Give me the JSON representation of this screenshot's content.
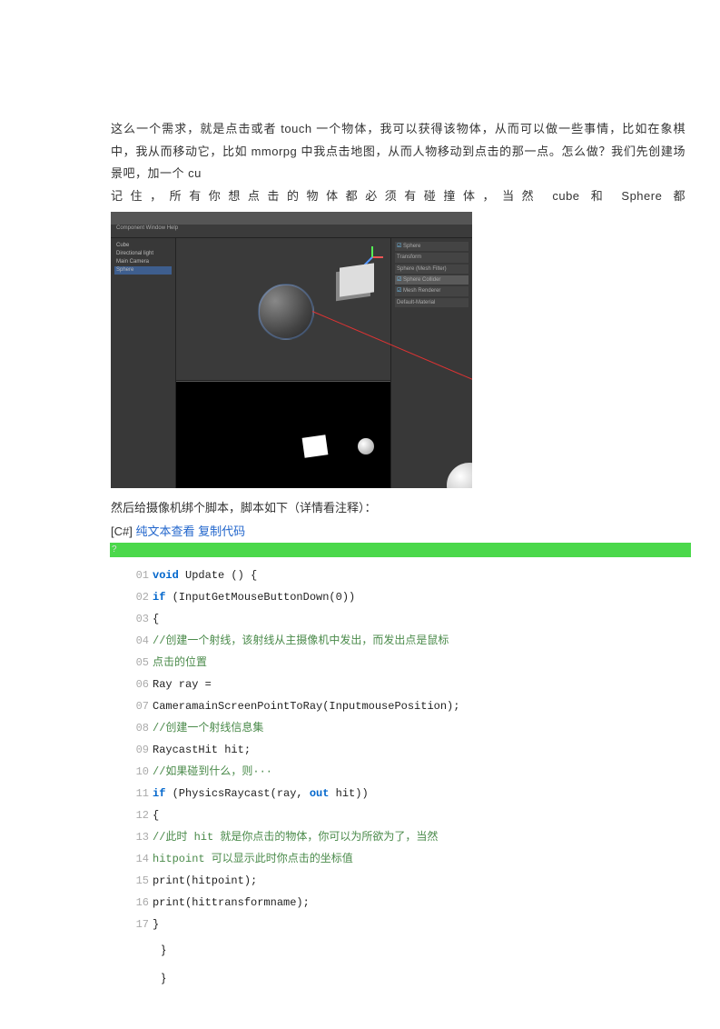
{
  "prose": {
    "p1": "这么一个需求，就是点击或者 touch 一个物体，我可以获得该物体，从而可以做一些事情，比如在象棋中，我从而移动它，比如 mmorpg 中我点击地图，从而人物移动到点击的那一点。怎么做？我们先创建场景吧，加一个 cu",
    "p2": "记住，所有你想点击的物体都必须有碰撞体，当然 cube 和 Sphere 都"
  },
  "caption": "然后给摄像机绑个脚本，脚本如下（详情看注释）：",
  "code_header": {
    "bracket": "[C#]",
    "link1": "纯文本查看",
    "link2": "复制代码"
  },
  "greenbar": "?",
  "code": [
    {
      "n": "01",
      "t": "kw",
      "s": "void",
      "rest": " Update () {"
    },
    {
      "n": "02",
      "t": "kw",
      "s": "if",
      "rest": " (InputGetMouseButtonDown(0))"
    },
    {
      "n": "03",
      "plain": "{"
    },
    {
      "n": "04",
      "cm": "//创建一个射线，该射线从主摄像机中发出，而发出点是鼠标"
    },
    {
      "n": "05",
      "cm": "点击的位置"
    },
    {
      "n": "06",
      "plain": "Ray ray ="
    },
    {
      "n": "07",
      "plain": "CameramainScreenPointToRay(InputmousePosition);"
    },
    {
      "n": "08",
      "cm": "//创建一个射线信息集"
    },
    {
      "n": "09",
      "plain": "RaycastHit hit;"
    },
    {
      "n": "10",
      "cm": "//如果碰到什么，则···"
    },
    {
      "n": "11",
      "t": "kw",
      "s": "if",
      "mid": " (PhysicsRaycast(ray, ",
      "t2": "kw2",
      "s2": "out",
      "rest2": " hit))"
    },
    {
      "n": "12",
      "plain": "{"
    },
    {
      "n": "13",
      "cm": "//此时 hit 就是你点击的物体，你可以为所欲为了，当然"
    },
    {
      "n": "14",
      "cm": "hitpoint 可以显示此时你点击的坐标值"
    },
    {
      "n": "15",
      "plain": "print(hitpoint);"
    },
    {
      "n": "16",
      "plain": "print(hittransformname);"
    },
    {
      "n": "17",
      "plain": "}"
    }
  ],
  "braces": [
    "}",
    "}"
  ],
  "unity": {
    "menu": "Component  Window  Help",
    "hierarchy": [
      "Cube",
      "Directional light",
      "Main Camera",
      "Sphere"
    ],
    "inspector": [
      "Sphere",
      "Transform",
      "Sphere (Mesh Filter)",
      "Sphere Collider",
      "Mesh Renderer",
      "Default-Material"
    ]
  }
}
